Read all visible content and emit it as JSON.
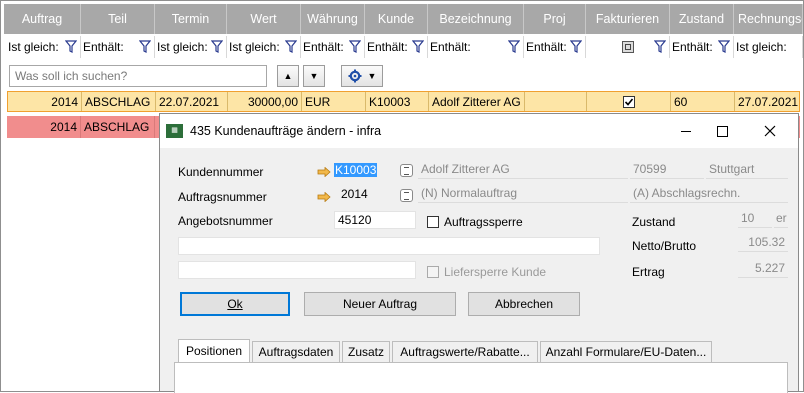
{
  "grid": {
    "headers": [
      "Auftrag",
      "Teil",
      "Termin",
      "Wert",
      "Währung",
      "Kunde",
      "Bezeichnung",
      "Proj",
      "Fakturieren",
      "Zustand",
      "Rechnungsd"
    ],
    "filters": [
      "Ist gleich:",
      "Enthält:",
      "Ist gleich:",
      "Ist gleich:",
      "Enthält:",
      "Enthält:",
      "Enthält:",
      "Enthält:",
      "",
      "Enthält:",
      "Ist gleich:"
    ],
    "search_placeholder": "Was soll ich suchen?",
    "rows": [
      {
        "auftrag": "2014",
        "teil": "ABSCHLAG",
        "termin": "22.07.2021",
        "wert": "30000,00",
        "waehrung": "EUR",
        "kunde": "K10003",
        "bezeichnung": "Adolf Zitterer AG",
        "proj": "",
        "fakturieren": true,
        "zustand": "60",
        "rechnungsdatum": "27.07.2021"
      },
      {
        "auftrag": "2014",
        "teil": "ABSCHLAG"
      }
    ]
  },
  "dialog": {
    "title": "435 Kundenaufträge ändern - infra",
    "kundennummer_label": "Kundennummer",
    "kundennummer_value": "K10003",
    "kunde_name": "Adolf Zitterer AG",
    "kunde_plz": "70599",
    "kunde_ort": "Stuttgart",
    "auftragsnummer_label": "Auftragsnummer",
    "auftragsnummer_value": "2014",
    "auftragsart": "(N) Normalauftrag",
    "abrechnungsart": "(A) Abschlagsrechn.",
    "angebotsnummer_label": "Angebotsnummer",
    "angebotsnummer_value": "45120",
    "auftragssperre_label": "Auftragssperre",
    "liefersperre_label": "Liefersperre Kunde",
    "zustand_label": "Zustand",
    "zustand_value": "10",
    "zustand_suffix": "er",
    "netto_label": "Netto/Brutto",
    "netto_value": "105.32",
    "ertrag_label": "Ertrag",
    "ertrag_value": "5.227",
    "ok_label": "Ok",
    "neuer_label": "Neuer Auftrag",
    "abbrechen_label": "Abbrechen",
    "tabs": [
      "Positionen",
      "Auftragsdaten",
      "Zusatz",
      "Auftragswerte/Rabatte...",
      "Anzahl Formulare/EU-Daten..."
    ]
  },
  "colors": {
    "header_bg": "#a8a8a8",
    "selected_row": "#fde5a6",
    "red_row": "#f18d8d",
    "dialog_bg": "#f0f0f0"
  }
}
